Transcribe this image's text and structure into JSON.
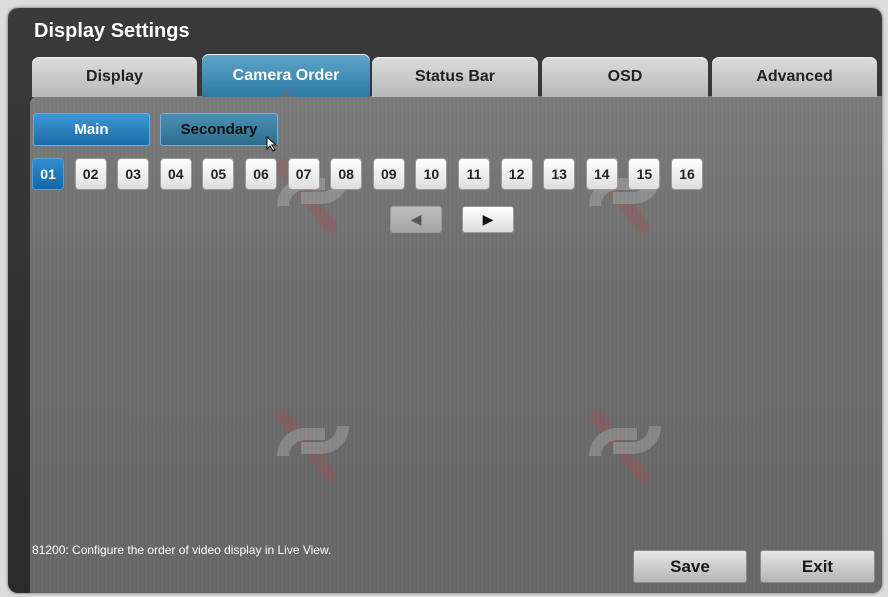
{
  "window": {
    "title": "Display Settings"
  },
  "tabs": [
    {
      "label": "Display",
      "active": false
    },
    {
      "label": "Camera Order",
      "active": true
    },
    {
      "label": "Status Bar",
      "active": false
    },
    {
      "label": "OSD",
      "active": false
    },
    {
      "label": "Advanced",
      "active": false
    }
  ],
  "modes": {
    "main": "Main",
    "secondary": "Secondary",
    "selected": "Main"
  },
  "cameras": [
    "01",
    "02",
    "03",
    "04",
    "05",
    "06",
    "07",
    "08",
    "09",
    "10",
    "11",
    "12",
    "13",
    "14",
    "15",
    "16"
  ],
  "selected_camera": "01",
  "pager": {
    "prev_icon": "triangle-left-icon",
    "next_icon": "triangle-right-icon"
  },
  "status_text": "81200: Configure the order of video display in Live View.",
  "actions": {
    "save": "Save",
    "exit": "Exit"
  },
  "colors": {
    "accent": "#2b7aa4",
    "selected": "#1a6ca8",
    "watermark": "#c0504d"
  }
}
